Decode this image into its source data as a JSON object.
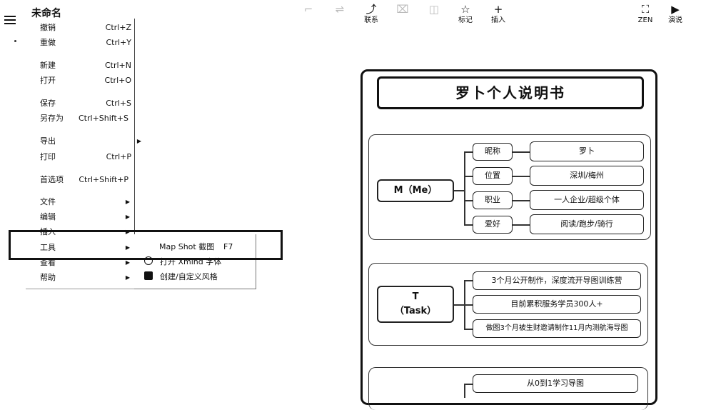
{
  "app": {
    "title": "未命名"
  },
  "toolbar": [
    {
      "icon": "⌐",
      "label": "",
      "faded": true
    },
    {
      "icon": "⇌",
      "label": "",
      "faded": true
    },
    {
      "icon": "⤴",
      "label": "联系",
      "faded": false
    },
    {
      "icon": "⌧",
      "label": "",
      "faded": true
    },
    {
      "icon": "◫",
      "label": "",
      "faded": true
    },
    {
      "icon": "☆",
      "label": "标记",
      "faded": false
    },
    {
      "icon": "+",
      "label": "插入",
      "faded": false
    }
  ],
  "toolbar_right": [
    {
      "icon": "⛶",
      "label": "ZEN"
    },
    {
      "icon": "▶",
      "label": "演说"
    }
  ],
  "menu": [
    {
      "label": "撤销",
      "shortcut": "Ctrl+Z"
    },
    {
      "label": "重做",
      "shortcut": "Ctrl+Y"
    },
    {
      "label": "新建",
      "shortcut": "Ctrl+N"
    },
    {
      "label": "打开",
      "shortcut": "Ctrl+O"
    },
    {
      "label": "保存",
      "shortcut": "Ctrl+S"
    },
    {
      "label": "另存为",
      "shortcut": "Ctrl+Shift+S"
    },
    {
      "label": "导出",
      "shortcut": ""
    },
    {
      "label": "打印",
      "shortcut": "Ctrl+P"
    },
    {
      "label": "首选项",
      "shortcut": "Ctrl+Shift+P"
    },
    {
      "label": "文件",
      "shortcut": ""
    },
    {
      "label": "编辑",
      "shortcut": ""
    },
    {
      "label": "插入",
      "shortcut": ""
    },
    {
      "label": "工具",
      "shortcut": ""
    },
    {
      "label": "查看",
      "shortcut": ""
    },
    {
      "label": "帮助",
      "shortcut": ""
    }
  ],
  "submenu": [
    {
      "label": "Map Shot 截图",
      "shortcut": "F7"
    },
    {
      "label": "打开 Xmind 字体",
      "shortcut": ""
    },
    {
      "label": "创建/自定义风格",
      "shortcut": ""
    }
  ],
  "mindmap": {
    "title": "罗卜个人说明书",
    "section1": {
      "root": "M（Me）",
      "items": [
        {
          "key": "昵称",
          "value": "罗卜"
        },
        {
          "key": "位置",
          "value": "深圳/梅州"
        },
        {
          "key": "职业",
          "value": "一人企业/超级个体"
        },
        {
          "key": "爱好",
          "value": "阅读/跑步/骑行"
        }
      ]
    },
    "section2": {
      "root_line1": "T",
      "root_line2": "（Task）",
      "items": [
        "3个月公开制作，深度流开导图训练营",
        "目前累积服务学员300人+",
        "做图3个月被生财邀请制作11月内测航海导图"
      ]
    },
    "section3": {
      "items": [
        "从0到1学习导图"
      ]
    }
  }
}
